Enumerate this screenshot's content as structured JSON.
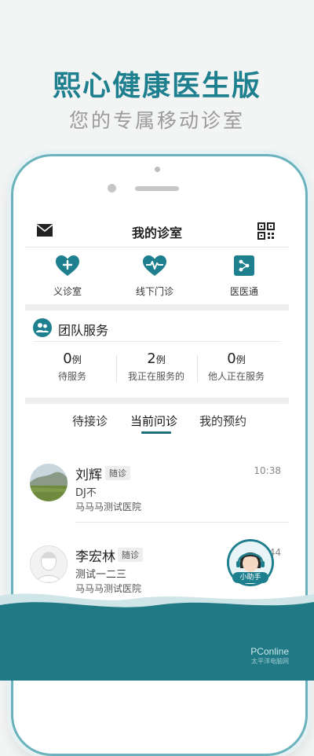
{
  "promo": {
    "title": "熙心健康医生版",
    "subtitle": "您的专属移动诊室"
  },
  "header": {
    "title": "我的诊室"
  },
  "quick_actions": [
    {
      "label": "义诊室",
      "icon": "heart-plus-icon"
    },
    {
      "label": "线下门诊",
      "icon": "heart-pulse-icon"
    },
    {
      "label": "医医通",
      "icon": "doctor-network-icon"
    }
  ],
  "team": {
    "title": "团队服务",
    "stats": [
      {
        "value": "0",
        "unit": "例",
        "label": "待服务"
      },
      {
        "value": "2",
        "unit": "例",
        "label": "我正在服务的"
      },
      {
        "value": "0",
        "unit": "例",
        "label": "他人正在服务"
      }
    ]
  },
  "tabs": [
    {
      "label": "待接诊"
    },
    {
      "label": "当前问诊",
      "active": true
    },
    {
      "label": "我的预约"
    }
  ],
  "consultations": [
    {
      "name": "刘辉",
      "tag": "随诊",
      "message": "DJ不",
      "hospital": "马马马测试医院",
      "time": "10:38"
    },
    {
      "name": "李宏林",
      "tag": "随诊",
      "message": "测试一二三",
      "hospital": "马马马测试医院",
      "time": "0 44"
    }
  ],
  "assistant": {
    "label": "小助手"
  },
  "watermark": {
    "brand": "PConline",
    "sub": "太平洋电脑网"
  },
  "colors": {
    "accent": "#1e7f8e",
    "wave": "#1f7a86"
  }
}
